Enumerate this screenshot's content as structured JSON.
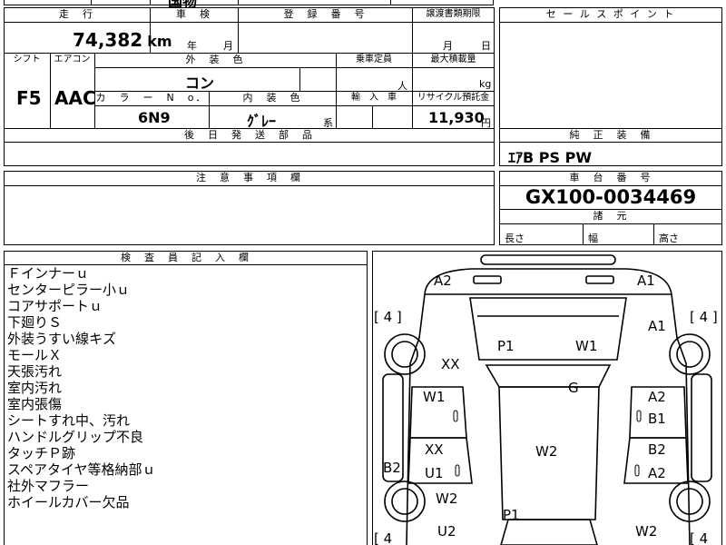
{
  "top_strip": {
    "partial_text": "国物"
  },
  "mileage": {
    "header": "走　行",
    "value": "74,382",
    "unit": "km"
  },
  "shaken": {
    "header": "車　検",
    "year_label": "年",
    "month_label": "月"
  },
  "registration": {
    "header": "登　録　番　号"
  },
  "transfer_doc": {
    "header": "譲渡書類期限",
    "month_label": "月",
    "day_label": "日"
  },
  "shift": {
    "header": "シフト",
    "value": "F5"
  },
  "aircon": {
    "header": "エアコン",
    "value": "AAC"
  },
  "exterior_color": {
    "header": "外　装　色",
    "value": "コン"
  },
  "capacity": {
    "header": "乗車定員",
    "unit": "人"
  },
  "max_load": {
    "header": "最大積載量",
    "unit": "kg"
  },
  "color_no": {
    "header": "カ　ラ　ー　N　o．",
    "value": "6N9"
  },
  "interior_color": {
    "header": "内　装　色",
    "value": "ｸﾞﾚｰ",
    "suffix": "系"
  },
  "import_car": {
    "header": "輸　入　車"
  },
  "recycle": {
    "header": "リサイクル預託金",
    "value": "11,930",
    "unit": "円"
  },
  "later_parts": {
    "header": "後　日　発　送　部　品"
  },
  "sales_points": {
    "header": "セ ー ル ス ポ イ ン ト"
  },
  "genuine_equipment": {
    "header": "純　正　装　備",
    "value": "ｴｱB PS PW"
  },
  "caution": {
    "header": "注　意　事　項　欄"
  },
  "chassis": {
    "header": "車　台　番　号",
    "value": "GX100-0034469"
  },
  "dimensions": {
    "header": "諸　元",
    "length_label": "長さ",
    "width_label": "幅",
    "height_label": "高さ"
  },
  "inspector": {
    "header": "検　査　員　記　入　欄",
    "notes": [
      "Ｆインナーｕ",
      "センターピラー小ｕ",
      "コアサポートｕ",
      "下廻りＳ",
      "外装うすい線キズ",
      "モールＸ",
      "天張汚れ",
      "室内汚れ",
      "室内張傷",
      "シートすれ中、汚れ",
      "ハンドルグリップ不良",
      "タッチＰ跡",
      "スペアタイヤ等格納部ｕ",
      "社外マフラー",
      "ホイールカバー欠品"
    ]
  },
  "diagram": {
    "labels": {
      "a2_top_left": "A2",
      "a1_top_right": "A1",
      "a1_right": "A1",
      "p1_top": "P1",
      "w1_top": "W1",
      "xx_left": "XX",
      "g_center": "G",
      "w1_left_door": "W1",
      "a2_right_door": "A2",
      "b1_right_door": "B1",
      "xx_left_rear": "XX",
      "u1_left_rear": "U1",
      "w2_center": "W2",
      "b2_right_rear": "B2",
      "a2_right_rear": "A2",
      "b2_left_side": "B2",
      "w2_left": "W2",
      "p1_bottom": "P1",
      "u2_bottom": "U2",
      "w2_bottom_right": "W2"
    },
    "tire_marks": {
      "top_left": "[ 4 ]",
      "top_right": "[ 4 ]",
      "bottom_left": "[ 4",
      "bottom_right": "[ 4"
    }
  }
}
